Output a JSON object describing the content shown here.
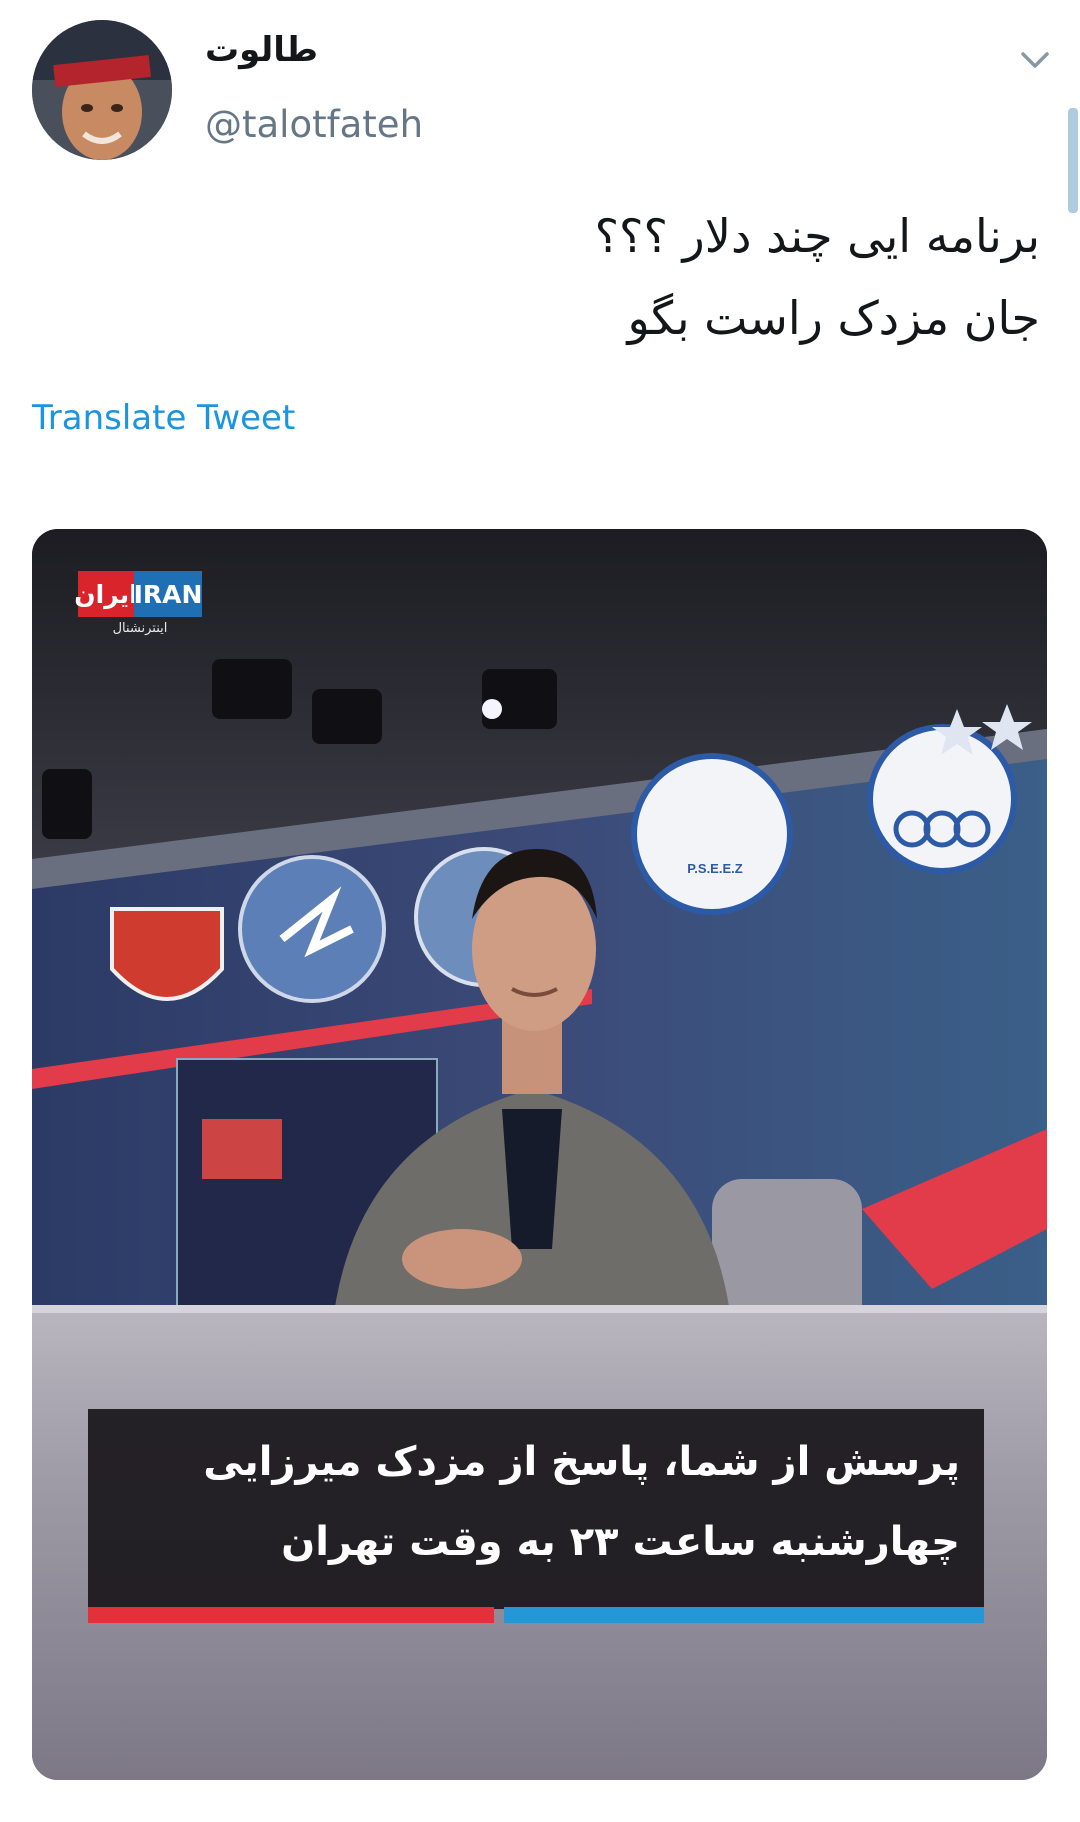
{
  "tweet": {
    "display_name": "طالوت",
    "handle": "@talotfateh",
    "text_lines": [
      "برنامه ایی چند دلار ؟؟؟",
      "جان مزدک راست بگو"
    ],
    "translate_label": "Translate Tweet"
  },
  "media": {
    "logo": {
      "left": "ایران",
      "right": "IRAN",
      "subtitle": "اینترنشنال"
    },
    "caption_lines": [
      "پرسش از شما، پاسخ از مزدک میرزایی",
      "چهارشنبه ساعت ۲۳ به وقت تهران"
    ],
    "badge_text": "P.S.E.E.Z"
  },
  "icons": {
    "menu": "chevron-down-icon"
  },
  "colors": {
    "link": "#1b95e0",
    "handle": "#657786",
    "caption_red": "#e3303a",
    "caption_blue": "#2596d6"
  }
}
